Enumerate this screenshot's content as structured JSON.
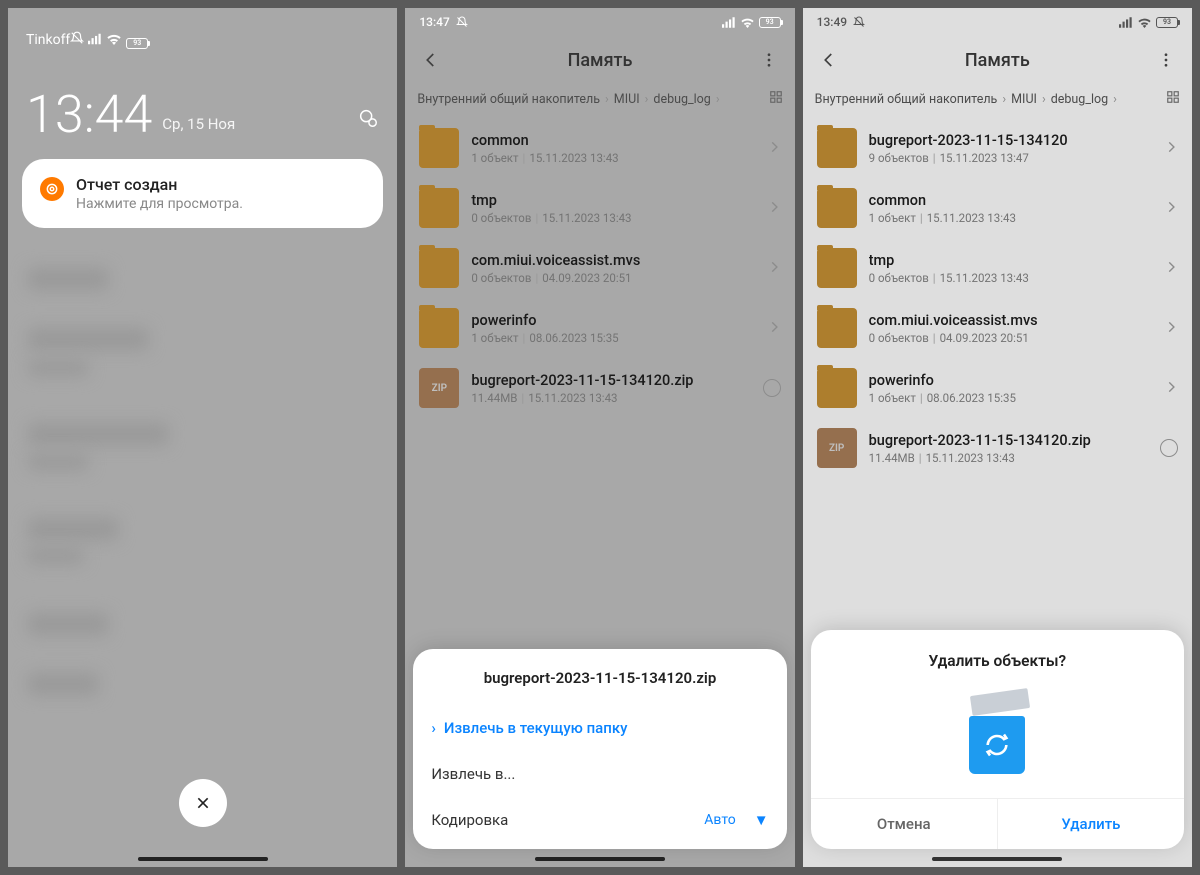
{
  "panel1": {
    "carrier": "Tinkoff",
    "time": "13:44",
    "date": "Ср, 15 Ноя",
    "battery": "93",
    "notification": {
      "title": "Отчет создан",
      "body": "Нажмите для просмотра."
    }
  },
  "panel2": {
    "status_time": "13:47",
    "battery": "93",
    "header_title": "Память",
    "breadcrumb": [
      "Внутренний общий накопитель",
      "MIUI",
      "debug_log"
    ],
    "files": [
      {
        "name": "common",
        "meta1": "1 объект",
        "meta2": "15.11.2023 13:43",
        "type": "folder"
      },
      {
        "name": "tmp",
        "meta1": "0 объектов",
        "meta2": "15.11.2023 13:43",
        "type": "folder"
      },
      {
        "name": "com.miui.voiceassist.mvs",
        "meta1": "0 объектов",
        "meta2": "04.09.2023 20:51",
        "type": "folder"
      },
      {
        "name": "powerinfo",
        "meta1": "1 объект",
        "meta2": "08.06.2023 15:35",
        "type": "folder"
      },
      {
        "name": "bugreport-2023-11-15-134120.zip",
        "meta1": "11.44MB",
        "meta2": "15.11.2023 13:43",
        "type": "zip"
      }
    ],
    "sheet": {
      "title": "bugreport-2023-11-15-134120.zip",
      "extract_here": "Извлечь в текущую папку",
      "extract_to": "Извлечь в...",
      "encoding_label": "Кодировка",
      "encoding_value": "Авто"
    }
  },
  "panel3": {
    "status_time": "13:49",
    "battery": "93",
    "header_title": "Память",
    "breadcrumb": [
      "Внутренний общий накопитель",
      "MIUI",
      "debug_log"
    ],
    "files": [
      {
        "name": "bugreport-2023-11-15-134120",
        "meta1": "9 объектов",
        "meta2": "15.11.2023 13:47",
        "type": "folder"
      },
      {
        "name": "common",
        "meta1": "1 объект",
        "meta2": "15.11.2023 13:43",
        "type": "folder"
      },
      {
        "name": "tmp",
        "meta1": "0 объектов",
        "meta2": "15.11.2023 13:43",
        "type": "folder"
      },
      {
        "name": "com.miui.voiceassist.mvs",
        "meta1": "0 объектов",
        "meta2": "04.09.2023 20:51",
        "type": "folder"
      },
      {
        "name": "powerinfo",
        "meta1": "1 объект",
        "meta2": "08.06.2023 15:35",
        "type": "folder"
      },
      {
        "name": "bugreport-2023-11-15-134120.zip",
        "meta1": "11.44MB",
        "meta2": "15.11.2023 13:43",
        "type": "zip"
      }
    ],
    "delete": {
      "title": "Удалить объекты?",
      "cancel": "Отмена",
      "confirm": "Удалить"
    }
  },
  "icons": {
    "zip_label": "ZIP"
  }
}
